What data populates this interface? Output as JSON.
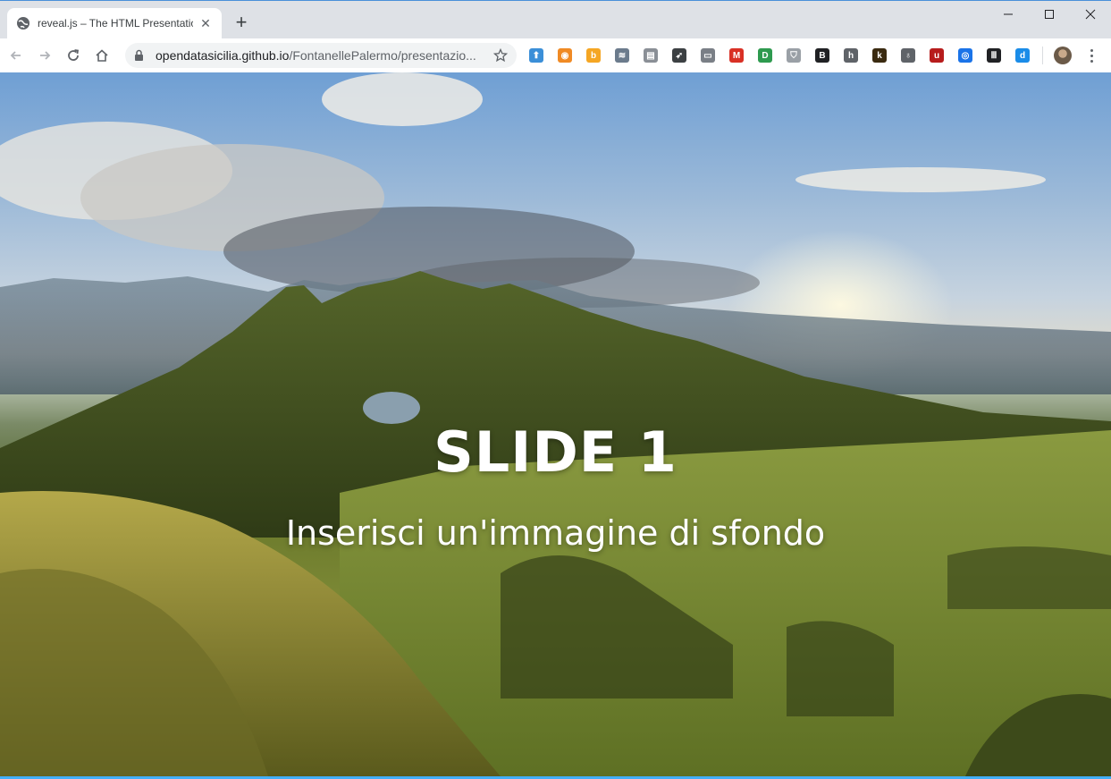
{
  "browser": {
    "tab": {
      "title": "reveal.js – The HTML Presentation Framework",
      "close_symbol": "✕"
    },
    "new_tab_symbol": "+",
    "window_controls": {
      "minimize": "—",
      "maximize": "☐",
      "close": "✕"
    },
    "address_bar": {
      "domain": "opendatasicilia.github.io",
      "path": "/FontanellePalermo/presentazio..."
    },
    "extensions": [
      {
        "name": "arrow-up-icon",
        "color": "#3b8fd8",
        "glyph": "⬆"
      },
      {
        "name": "rss-icon",
        "color": "#f08a24",
        "glyph": "◉"
      },
      {
        "name": "orange-b-icon",
        "color": "#f5a623",
        "glyph": "b"
      },
      {
        "name": "pipes-icon",
        "color": "#6b7b8c",
        "glyph": "≋"
      },
      {
        "name": "pane-icon",
        "color": "#8a8f96",
        "glyph": "▤"
      },
      {
        "name": "rocket-icon",
        "color": "#3c4043",
        "glyph": "➶"
      },
      {
        "name": "reader-icon",
        "color": "#7a7f86",
        "glyph": "▭"
      },
      {
        "name": "gmail-icon",
        "color": "#d93025",
        "glyph": "M"
      },
      {
        "name": "green-circle-icon",
        "color": "#2e9a4f",
        "glyph": "D"
      },
      {
        "name": "shield-outline-icon",
        "color": "#9aa0a6",
        "glyph": "⛉"
      },
      {
        "name": "b-box-icon",
        "color": "#202124",
        "glyph": "B"
      },
      {
        "name": "h-icon",
        "color": "#5f6368",
        "glyph": "h"
      },
      {
        "name": "k-icon",
        "color": "#3a2a10",
        "glyph": "k"
      },
      {
        "name": "bulb-icon",
        "color": "#5f6368",
        "glyph": "♁"
      },
      {
        "name": "ublock-icon",
        "color": "#b71c1c",
        "glyph": "u"
      },
      {
        "name": "eye-icon",
        "color": "#1a73e8",
        "glyph": "◎"
      },
      {
        "name": "columns-icon",
        "color": "#202124",
        "glyph": "Ⅲ"
      },
      {
        "name": "d-icon",
        "color": "#1a8ce8",
        "glyph": "d"
      }
    ]
  },
  "slide": {
    "title": "SLIDE 1",
    "subtitle": "Inserisci un'immagine di sfondo"
  },
  "colors": {
    "progress_bar": "#42affa"
  }
}
